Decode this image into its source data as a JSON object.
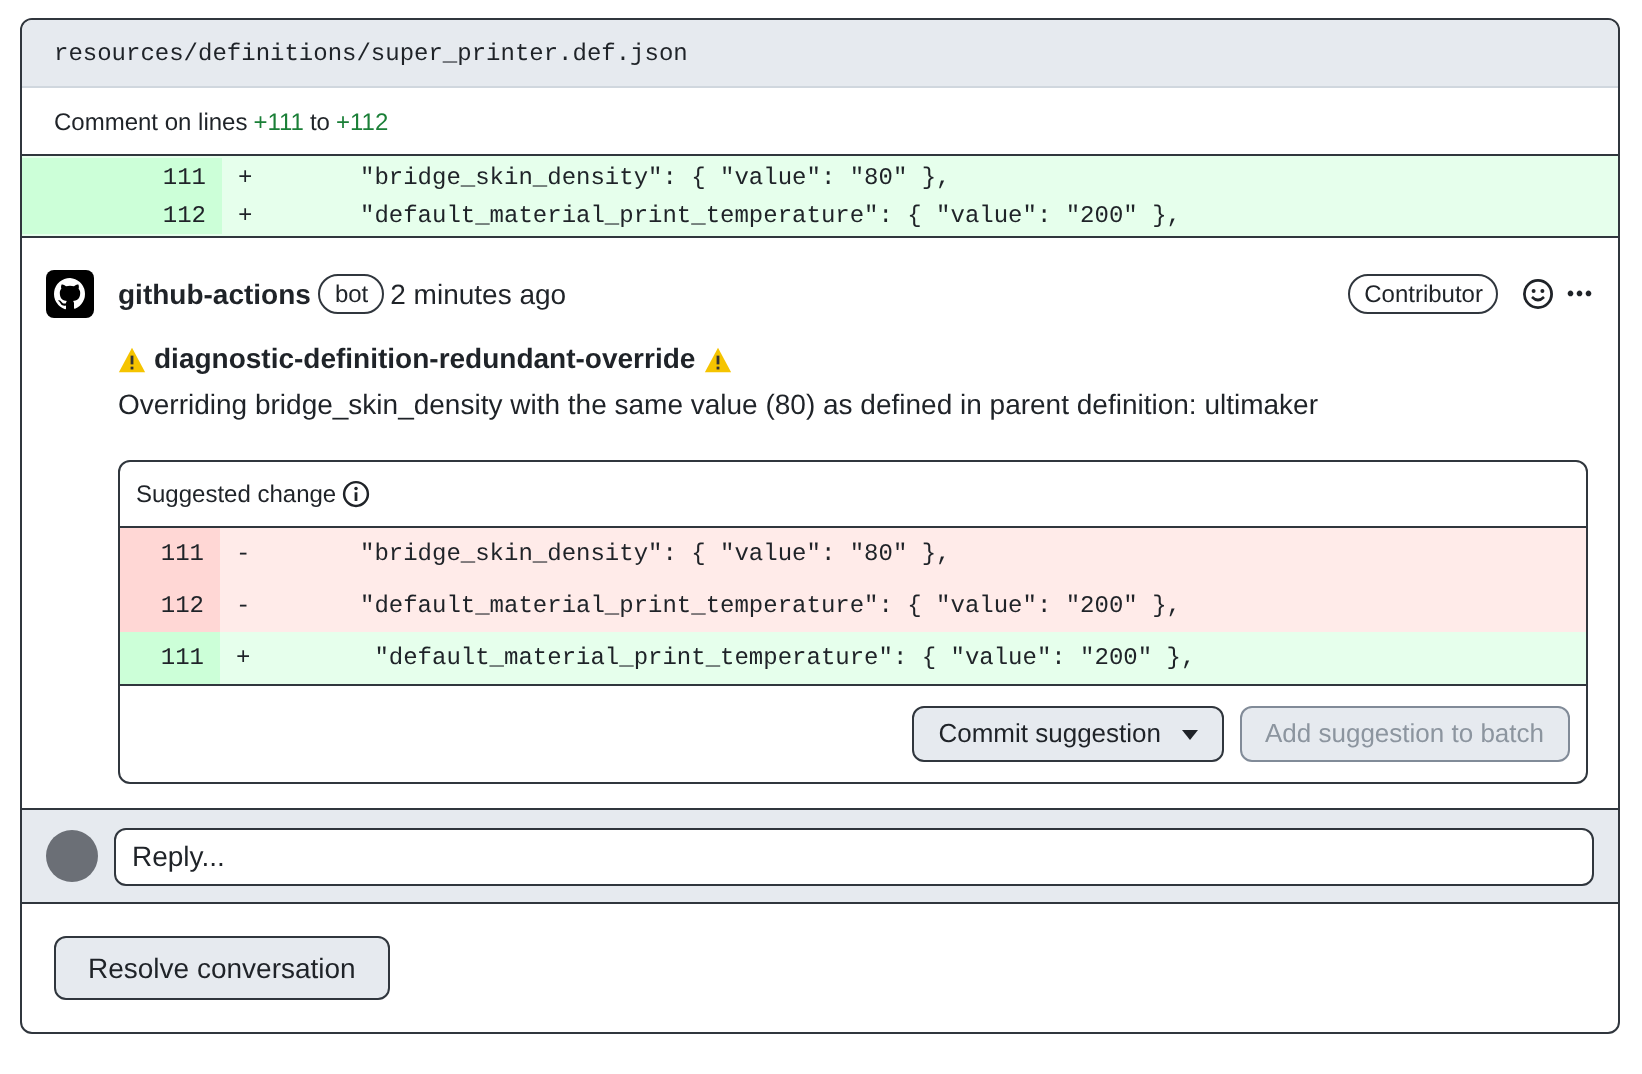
{
  "file": {
    "path": "resources/definitions/super_printer.def.json"
  },
  "comment_range": {
    "prefix": "Comment on lines",
    "start": "+111",
    "middle": "to",
    "end": "+112"
  },
  "context_lines": [
    {
      "kind": "add",
      "number": "111",
      "sign": "+",
      "code": "\"bridge_skin_density\": { \"value\": \"80\" },"
    },
    {
      "kind": "add",
      "number": "112",
      "sign": "+",
      "code": "\"default_material_print_temperature\": { \"value\": \"200\" },"
    }
  ],
  "comment": {
    "author": "github-actions",
    "author_badge": "bot",
    "time": "2 minutes ago",
    "role_badge": "Contributor",
    "more": "•••",
    "title": "diagnostic-definition-redundant-override",
    "body": "Overriding bridge_skin_density with the same value (80) as defined in parent definition: ultimaker",
    "suggestion": {
      "title": "Suggested change",
      "lines": [
        {
          "kind": "del",
          "number": "111",
          "sign": "-",
          "code": "\"bridge_skin_density\": { \"value\": \"80\" },"
        },
        {
          "kind": "del",
          "number": "112",
          "sign": "-",
          "code": "\"default_material_print_temperature\": { \"value\": \"200\" },"
        },
        {
          "kind": "add",
          "number": "111",
          "sign": "+",
          "code": " \"default_material_print_temperature\": { \"value\": \"200\" },"
        }
      ],
      "buttons": [
        {
          "label": "Commit suggestion",
          "kind": "dropdown",
          "disabled": false
        },
        {
          "label": "Add suggestion to batch",
          "kind": "plain",
          "disabled": true
        }
      ]
    }
  },
  "reply": {
    "placeholder": "Reply..."
  },
  "resolve_button": "Resolve conversation"
}
